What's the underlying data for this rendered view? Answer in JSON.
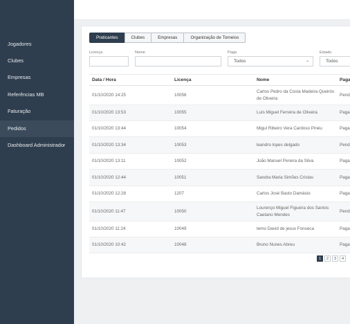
{
  "sidebar": {
    "items": [
      {
        "label": "Jogadores"
      },
      {
        "label": "Clubes"
      },
      {
        "label": "Empresas"
      },
      {
        "label": "Referências MB"
      },
      {
        "label": "Faturação"
      },
      {
        "label": "Pedidos"
      },
      {
        "label": "Dashboard Administrador"
      }
    ]
  },
  "tabs": [
    {
      "label": "Praticantes"
    },
    {
      "label": "Clubes"
    },
    {
      "label": "Empresas"
    },
    {
      "label": "Organização de Torneios"
    }
  ],
  "filters": {
    "licenca_label": "Licença",
    "nome_label": "Nome",
    "paga_label": "Paga",
    "paga_value": "Todos",
    "estado_label": "Estado",
    "estado_value": "Todos"
  },
  "table": {
    "headers": [
      "Data / Hora",
      "Licença",
      "Nome",
      "Paga"
    ],
    "rows": [
      {
        "date": "01/10/2020 14:25",
        "lic": "10056",
        "name": "Carlos Pedro da Costa Madeira Queirós de Oliveira",
        "paga": "Pend"
      },
      {
        "date": "01/10/2020 13:53",
        "lic": "10055",
        "name": "Luís Miguel Ferreira de Oliveira",
        "paga": "Paga"
      },
      {
        "date": "01/10/2020 13:44",
        "lic": "10054",
        "name": "Migul Ribeiro Vera Cardoso Pinéu",
        "paga": "Paga"
      },
      {
        "date": "01/10/2020 13:34",
        "lic": "10053",
        "name": "leandro lopes delgado",
        "paga": "Pend"
      },
      {
        "date": "01/10/2020 13:11",
        "lic": "10052",
        "name": "João Manuel Pereira da Silva",
        "paga": "Paga"
      },
      {
        "date": "01/10/2020 12:44",
        "lic": "10051",
        "name": "Sandra Maria Simões Cristas",
        "paga": "Paga"
      },
      {
        "date": "01/10/2020 12:28",
        "lic": "1207",
        "name": "Carlos José Basto Damásio",
        "paga": "Paga"
      },
      {
        "date": "01/10/2020 11:47",
        "lic": "10050",
        "name": "Lourenço Miguel Figueira dos Santos Caetano Mendes",
        "paga": "Pend"
      },
      {
        "date": "01/10/2020 11:24",
        "lic": "10049",
        "name": "temo David de jesus Fonseca",
        "paga": "Paga"
      },
      {
        "date": "01/10/2020 10:42",
        "lic": "10048",
        "name": "Bruno Nunes Abreu",
        "paga": "Paga"
      }
    ]
  },
  "pagination": [
    "1",
    "2",
    "3",
    "4"
  ]
}
